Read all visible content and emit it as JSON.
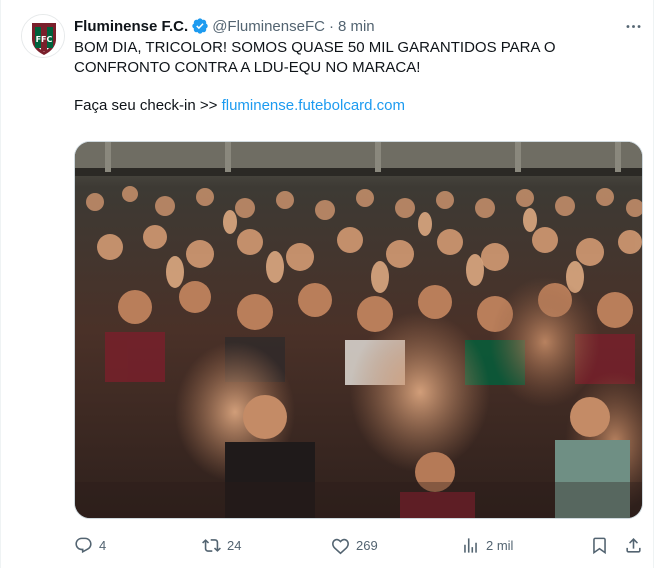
{
  "tweet": {
    "display_name": "Fluminense F.C.",
    "handle": "@FluminenseFC",
    "separator": "·",
    "time": "8 min",
    "text_line1": "BOM DIA, TRICOLOR! SOMOS QUASE 50 MIL GARANTIDOS PARA O",
    "text_line2": "CONFRONTO CONTRA A LDU-EQU NO MARACA!",
    "checkin_prefix": "Faça seu check-in >> ",
    "checkin_link": "fluminense.futebolcard.com",
    "media_alt": "Torcida do Fluminense com as mãos levantadas no estádio"
  },
  "actions": {
    "replies": "4",
    "reposts": "24",
    "likes": "269",
    "views": "2 mil"
  },
  "icons": {
    "avatar": "fluminense-crest",
    "verified": "verified-badge-icon",
    "more": "more-horizontal-icon",
    "reply": "reply-icon",
    "repost": "repost-icon",
    "like": "heart-icon",
    "views": "views-chart-icon",
    "bookmark": "bookmark-icon",
    "share": "share-icon"
  },
  "colors": {
    "text": "#0f1419",
    "secondary": "#536471",
    "link": "#1d9bf0",
    "verified": "#1d9bf0",
    "club_maroon": "#7a1f2b",
    "club_green": "#00613c"
  }
}
